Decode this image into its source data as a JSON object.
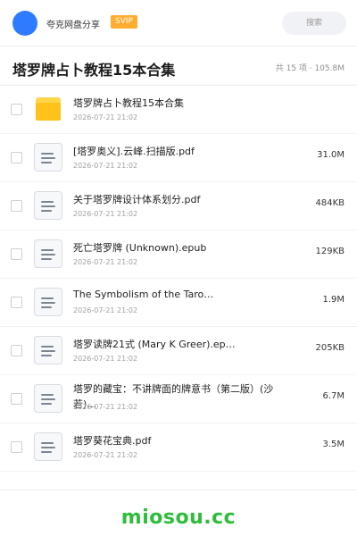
{
  "header": {
    "brand": "夸克网盘分享",
    "badge": "SVIP",
    "search_placeholder": "搜索"
  },
  "folder": {
    "title": "塔罗牌占卜教程15本合集",
    "count_info": "共 15 项 · 105.8M"
  },
  "files": [
    {
      "icon": "folder-icon",
      "name": "塔罗牌占卜教程15本合集",
      "date": "2026-07-21 21:02",
      "size": ""
    },
    {
      "icon": "document-icon",
      "name": "[塔罗奥义].云峰.扫描版.pdf",
      "date": "2026-07-21 21:02",
      "size": "31.0M"
    },
    {
      "icon": "document-icon",
      "name": "关于塔罗牌设计体系划分.pdf",
      "date": "2026-07-21 21:02",
      "size": "484KB"
    },
    {
      "icon": "document-icon",
      "name": "死亡塔罗牌 (Unknown).epub",
      "date": "2026-07-21 21:02",
      "size": "129KB"
    },
    {
      "icon": "document-icon",
      "name": "The Symbolism of the Taro…",
      "date": "2026-07-21 21:02",
      "size": "1.9M"
    },
    {
      "icon": "document-icon",
      "name": "塔罗读牌21式 (Mary K Greer).ep…",
      "date": "2026-07-21 21:02",
      "size": "205KB"
    },
    {
      "icon": "document-icon",
      "name": "塔罗的藏宝：不讲牌面的牌意书（第二版）(沙若)…",
      "date": "2026-07-21 21:02",
      "size": "6.7M"
    },
    {
      "icon": "document-icon",
      "name": "塔罗葵花宝典.pdf",
      "date": "2026-07-21 21:02",
      "size": "3.5M"
    }
  ],
  "footer": {
    "logo": "miosou.cc"
  },
  "colors": {
    "accent_blue": "#2f7bff",
    "svip_orange": "#ffad2f",
    "folder_yellow": "#ffc21a",
    "logo_green": "#2dbd3a"
  }
}
